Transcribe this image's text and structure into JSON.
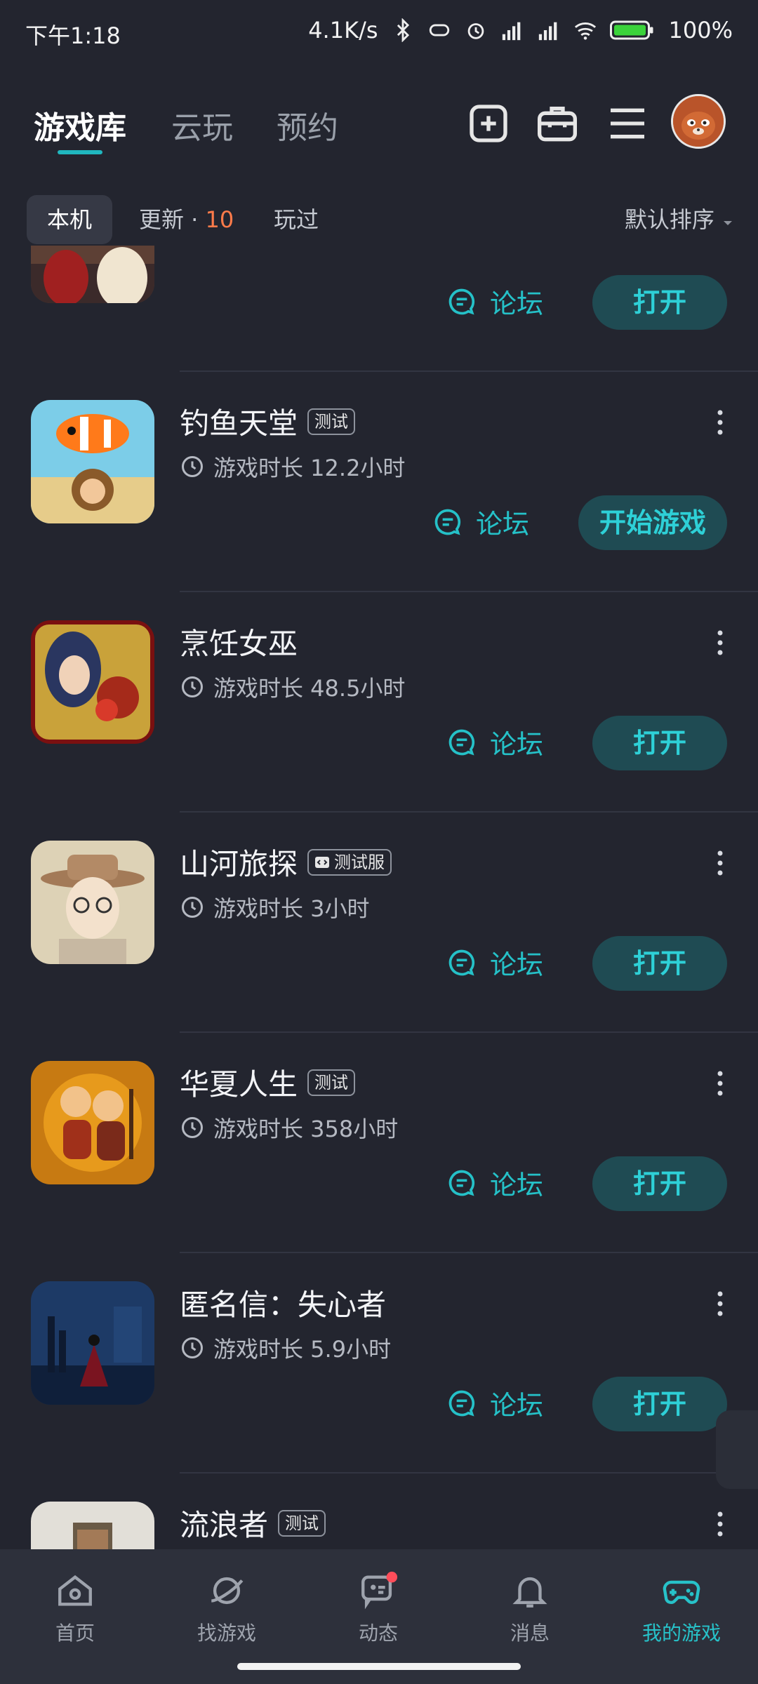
{
  "status": {
    "time": "下午1:18",
    "net_speed": "4.1K/s",
    "battery": "100%"
  },
  "header": {
    "tabs": [
      {
        "label": "游戏库",
        "active": true
      },
      {
        "label": "云玩",
        "active": false
      },
      {
        "label": "预约",
        "active": false
      }
    ],
    "icons": [
      "add-icon",
      "toolbox-icon",
      "menu-icon",
      "avatar"
    ]
  },
  "filters": {
    "local": "本机",
    "update_label": "更新 · ",
    "update_count": "10",
    "played": "玩过",
    "sort": "默认排序"
  },
  "games": [
    {
      "title": "",
      "badge": "",
      "playtime": "",
      "forum": "论坛",
      "action": "打开"
    },
    {
      "title": "钓鱼天堂",
      "badge": "测试",
      "playtime": "游戏时长 12.2小时",
      "forum": "论坛",
      "action": "开始游戏"
    },
    {
      "title": "烹饪女巫",
      "badge": "",
      "playtime": "游戏时长 48.5小时",
      "forum": "论坛",
      "action": "打开"
    },
    {
      "title": "山河旅探",
      "badge": "测试服",
      "playtime": "游戏时长 3小时",
      "forum": "论坛",
      "action": "打开"
    },
    {
      "title": "华夏人生",
      "badge": "测试",
      "playtime": "游戏时长 358小时",
      "forum": "论坛",
      "action": "打开"
    },
    {
      "title": "匿名信：失心者",
      "badge": "",
      "playtime": "游戏时长 5.9小时",
      "forum": "论坛",
      "action": "打开"
    },
    {
      "title": "流浪者",
      "badge": "测试",
      "playtime": "",
      "forum": "",
      "action": ""
    }
  ],
  "bottom_nav": [
    {
      "label": "首页",
      "icon": "home-icon",
      "active": false
    },
    {
      "label": "找游戏",
      "icon": "planet-icon",
      "active": false
    },
    {
      "label": "动态",
      "icon": "chat-icon",
      "active": false,
      "dot": true
    },
    {
      "label": "消息",
      "icon": "bell-icon",
      "active": false
    },
    {
      "label": "我的游戏",
      "icon": "gamepad-icon",
      "active": true
    }
  ],
  "colors": {
    "accent": "#25c1c8",
    "background": "#23252f",
    "button_bg": "#1f4b53",
    "update_count": "#ff7b4a"
  }
}
